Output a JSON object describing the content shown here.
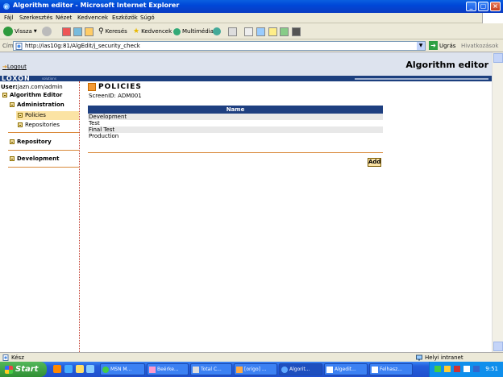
{
  "window": {
    "title": "Algorithm editor - Microsoft Internet Explorer"
  },
  "menu": [
    "Fájl",
    "Szerkesztés",
    "Nézet",
    "Kedvencek",
    "Eszközök",
    "Súgó"
  ],
  "toolbar": {
    "back": "Vissza",
    "search": "Keresés",
    "favorites": "Kedvencek",
    "media": "Multimédia"
  },
  "address": {
    "label": "Cím",
    "url": "http://ias10g:81/AlgEdit/j_security_check",
    "go": "Ugrás",
    "links": "Hivatkozások"
  },
  "app": {
    "logout": "Logout",
    "title": "Algorithm editor",
    "brand": "LOXON",
    "brand_sub": "solutions",
    "user_label": "User:",
    "user_value": "jazn.com/admin"
  },
  "tree": {
    "root": "Algorithm Editor",
    "administration": "Administration",
    "policies": "Policies",
    "repositories": "Repositories",
    "repository": "Repository",
    "development": "Development"
  },
  "main": {
    "heading": "POLICIES",
    "screen_id": "ScreenID: ADM001",
    "column_name": "Name",
    "rows": [
      "Development",
      "Test",
      "Final Test",
      "Production"
    ],
    "add": "Add"
  },
  "status": {
    "text": "Kész",
    "zone": "Helyi intranet"
  },
  "taskbar": {
    "start": "Start",
    "tasks": [
      "MSN M...",
      "Beérke...",
      "Total C...",
      "[origo] ...",
      "Algorit...",
      "Algedit...",
      "Felhasz..."
    ],
    "clock": "9:51"
  }
}
